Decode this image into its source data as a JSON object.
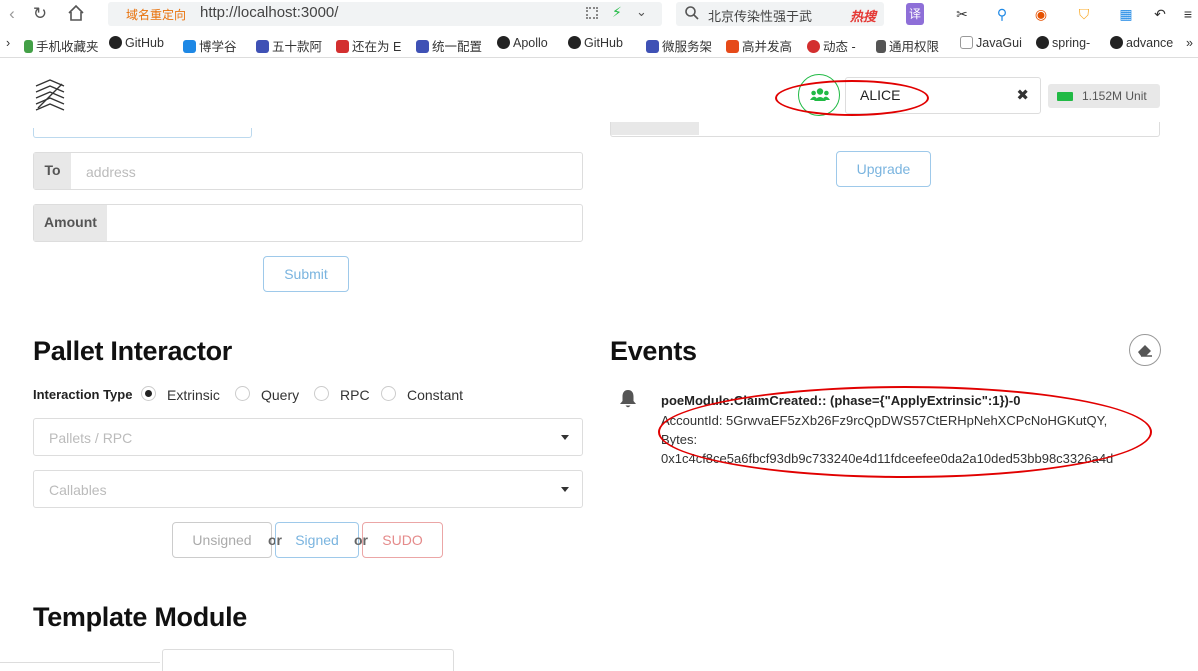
{
  "browser": {
    "nav": {
      "back_icon": "chevron-left-icon",
      "reload_icon": "reload-icon",
      "home_icon": "home-icon"
    },
    "url_redirect_label": "域名重定向",
    "url": "http://localhost:3000/",
    "search_text": "北京传染性强于武",
    "search_hot": "热搜",
    "toolbar_labels": {
      "translate": "译"
    },
    "bookmarks": [
      "手机收藏夹",
      "GitHub",
      "博学谷",
      "五十款阿",
      "还在为 E",
      "统一配置",
      "Apollo",
      "GitHub",
      "微服务架",
      "高并发高",
      "动态 -",
      "通用权限",
      "JavaGui",
      "spring-",
      "advance"
    ],
    "bookmarks_more": "»"
  },
  "header": {
    "account_icon": "users-icon",
    "account_name": "ALICE",
    "clear_icon": "close-icon",
    "balance_icon": "money-icon",
    "balance": "1.152M Unit"
  },
  "transfer": {
    "to_label": "To",
    "to_placeholder": "address",
    "amount_label": "Amount",
    "submit_label": "Submit"
  },
  "upgrade": {
    "button_label": "Upgrade"
  },
  "pallet_interactor": {
    "title": "Pallet Interactor",
    "interaction_type_label": "Interaction Type",
    "options": [
      "Extrinsic",
      "Query",
      "RPC",
      "Constant"
    ],
    "selected_option": "Extrinsic",
    "pallets_placeholder": "Pallets / RPC",
    "callables_placeholder": "Callables",
    "unsigned_label": "Unsigned",
    "signed_label": "Signed",
    "sudo_label": "SUDO",
    "or_label": "or"
  },
  "events": {
    "title": "Events",
    "clear_icon": "eraser-icon",
    "items": [
      {
        "icon": "bell-icon",
        "title": "poeModule:ClaimCreated:: (phase={\"ApplyExtrinsic\":1})-0",
        "line1": "AccountId: 5GrwvaEF5zXb26Fz9rcQpDWS57CtERHpNehXCPcNoHGKutQY,",
        "line2": "Bytes:",
        "line3": "0x1c4cf8ce5a6fbcf93db9c733240e4d11fdceefee0da2a10ded53bb98c3326a4d"
      }
    ]
  },
  "template_module": {
    "title": "Template Module"
  },
  "colors": {
    "annotation": "#e10000",
    "accent_green": "#21ba45",
    "primary_blue": "#2185d0",
    "sudo_red": "#db2828"
  }
}
